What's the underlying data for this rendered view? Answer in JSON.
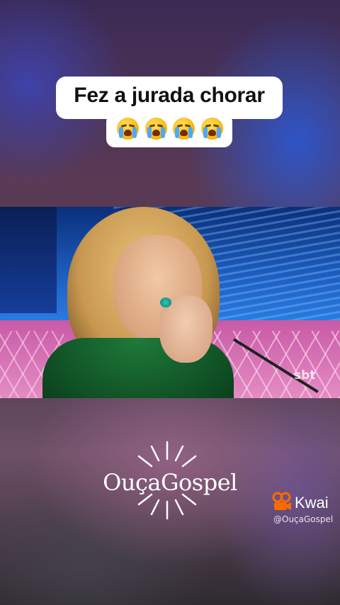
{
  "caption": {
    "title": "Fez a jurada chorar",
    "emojis": [
      "loudly-crying-face-icon",
      "loudly-crying-face-icon",
      "loudly-crying-face-icon",
      "loudly-crying-face-icon"
    ]
  },
  "video": {
    "channel_watermark": "sbt"
  },
  "brand": {
    "name": "OuçaGospel"
  },
  "watermark": {
    "app_name": "Kwai",
    "handle": "@OuçaGospel",
    "accent": "#ff6a00"
  }
}
